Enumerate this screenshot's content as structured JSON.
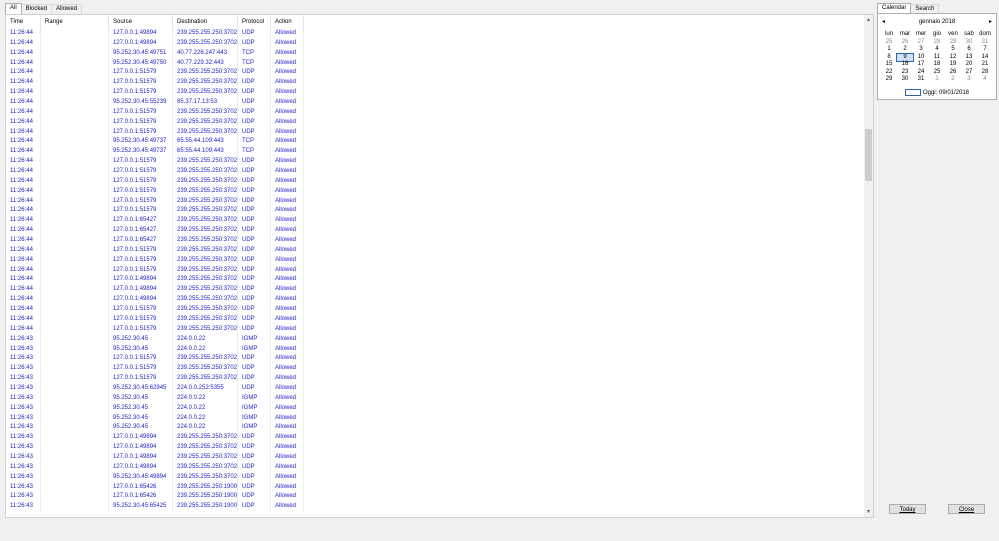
{
  "tabs": [
    "All",
    "Blocked",
    "Allowed"
  ],
  "columns": {
    "time": "Time",
    "range": "Range",
    "source": "Source",
    "destination": "Destination",
    "protocol": "Protocol",
    "action": "Action"
  },
  "rows": [
    [
      "11:26:44",
      "",
      "127.0.0.1:49894",
      "239.255.255.250:3702",
      "UDP",
      "Allowed"
    ],
    [
      "11:26:44",
      "",
      "127.0.0.1:49894",
      "239.255.255.250:3702",
      "UDP",
      "Allowed"
    ],
    [
      "11:26:44",
      "",
      "95.252.30.45:49751",
      "40.77.226.247:443",
      "TCP",
      "Allowed"
    ],
    [
      "11:26:44",
      "",
      "95.252.30.45:49750",
      "40.77.229.32:443",
      "TCP",
      "Allowed"
    ],
    [
      "11:26:44",
      "",
      "127.0.0.1:51579",
      "239.255.255.250:3702",
      "UDP",
      "Allowed"
    ],
    [
      "11:26:44",
      "",
      "127.0.0.1:51579",
      "239.255.255.250:3702",
      "UDP",
      "Allowed"
    ],
    [
      "11:26:44",
      "",
      "127.0.0.1:51579",
      "239.255.255.250:3702",
      "UDP",
      "Allowed"
    ],
    [
      "11:26:44",
      "",
      "95.252.30.45:55239",
      "85.37.17.13:53",
      "UDP",
      "Allowed"
    ],
    [
      "11:26:44",
      "",
      "127.0.0.1:51579",
      "239.255.255.250:3702",
      "UDP",
      "Allowed"
    ],
    [
      "11:26:44",
      "",
      "127.0.0.1:51579",
      "239.255.255.250:3702",
      "UDP",
      "Allowed"
    ],
    [
      "11:26:44",
      "",
      "127.0.0.1:51579",
      "239.255.255.250:3702",
      "UDP",
      "Allowed"
    ],
    [
      "11:26:44",
      "",
      "95.252.30.45:49737",
      "65.55.44.109:443",
      "TCP",
      "Allowed"
    ],
    [
      "11:26:44",
      "",
      "95.252.30.45:49737",
      "65.55.44.109:443",
      "TCP",
      "Allowed"
    ],
    [
      "11:26:44",
      "",
      "127.0.0.1:51579",
      "239.255.255.250:3702",
      "UDP",
      "Allowed"
    ],
    [
      "11:26:44",
      "",
      "127.0.0.1:51579",
      "239.255.255.250:3702",
      "UDP",
      "Allowed"
    ],
    [
      "11:26:44",
      "",
      "127.0.0.1:51579",
      "239.255.255.250:3702",
      "UDP",
      "Allowed"
    ],
    [
      "11:26:44",
      "",
      "127.0.0.1:51579",
      "239.255.255.250:3702",
      "UDP",
      "Allowed"
    ],
    [
      "11:26:44",
      "",
      "127.0.0.1:51579",
      "239.255.255.250:3702",
      "UDP",
      "Allowed"
    ],
    [
      "11:26:44",
      "",
      "127.0.0.1:51579",
      "239.255.255.250:3702",
      "UDP",
      "Allowed"
    ],
    [
      "11:26:44",
      "",
      "127.0.0.1:65427",
      "239.255.255.250:3702",
      "UDP",
      "Allowed"
    ],
    [
      "11:26:44",
      "",
      "127.0.0.1:65427",
      "239.255.255.250:3702",
      "UDP",
      "Allowed"
    ],
    [
      "11:26:44",
      "",
      "127.0.0.1:65427",
      "239.255.255.250:3702",
      "UDP",
      "Allowed"
    ],
    [
      "11:26:44",
      "",
      "127.0.0.1:51579",
      "239.255.255.250:3702",
      "UDP",
      "Allowed"
    ],
    [
      "11:26:44",
      "",
      "127.0.0.1:51579",
      "239.255.255.250:3702",
      "UDP",
      "Allowed"
    ],
    [
      "11:26:44",
      "",
      "127.0.0.1:51579",
      "239.255.255.250:3702",
      "UDP",
      "Allowed"
    ],
    [
      "11:26:44",
      "",
      "127.0.0.1:49894",
      "239.255.255.250:3702",
      "UDP",
      "Allowed"
    ],
    [
      "11:26:44",
      "",
      "127.0.0.1:49894",
      "239.255.255.250:3702",
      "UDP",
      "Allowed"
    ],
    [
      "11:26:44",
      "",
      "127.0.0.1:49894",
      "239.255.255.250:3702",
      "UDP",
      "Allowed"
    ],
    [
      "11:26:44",
      "",
      "127.0.0.1:51579",
      "239.255.255.250:3702",
      "UDP",
      "Allowed"
    ],
    [
      "11:26:44",
      "",
      "127.0.0.1:51579",
      "239.255.255.250:3702",
      "UDP",
      "Allowed"
    ],
    [
      "11:26:44",
      "",
      "127.0.0.1:51579",
      "239.255.255.250:3702",
      "UDP",
      "Allowed"
    ],
    [
      "11:26:43",
      "",
      "95.252.30.45",
      "224.0.0.22",
      "IGMP",
      "Allowed"
    ],
    [
      "11:26:43",
      "",
      "95.252.30.45",
      "224.0.0.22",
      "IGMP",
      "Allowed"
    ],
    [
      "11:26:43",
      "",
      "127.0.0.1:51579",
      "239.255.255.250:3702",
      "UDP",
      "Allowed"
    ],
    [
      "11:26:43",
      "",
      "127.0.0.1:51579",
      "239.255.255.250:3702",
      "UDP",
      "Allowed"
    ],
    [
      "11:26:43",
      "",
      "127.0.0.1:51579",
      "239.255.255.250:3702",
      "UDP",
      "Allowed"
    ],
    [
      "11:26:43",
      "",
      "95.252.30.45:62945",
      "224.0.0.252:5355",
      "UDP",
      "Allowed"
    ],
    [
      "11:26:43",
      "",
      "95.252.30.45",
      "224.0.0.22",
      "IGMP",
      "Allowed"
    ],
    [
      "11:26:43",
      "",
      "95.252.30.45",
      "224.0.0.22",
      "IGMP",
      "Allowed"
    ],
    [
      "11:26:43",
      "",
      "95.252.30.45",
      "224.0.0.22",
      "IGMP",
      "Allowed"
    ],
    [
      "11:26:43",
      "",
      "95.252.30.45",
      "224.0.0.22",
      "IGMP",
      "Allowed"
    ],
    [
      "11:26:43",
      "",
      "127.0.0.1:49894",
      "239.255.255.250:3702",
      "UDP",
      "Allowed"
    ],
    [
      "11:26:43",
      "",
      "127.0.0.1:49894",
      "239.255.255.250:3702",
      "UDP",
      "Allowed"
    ],
    [
      "11:26:43",
      "",
      "127.0.0.1:49894",
      "239.255.255.250:3702",
      "UDP",
      "Allowed"
    ],
    [
      "11:26:43",
      "",
      "127.0.0.1:49894",
      "239.255.255.250:3702",
      "UDP",
      "Allowed"
    ],
    [
      "11:26:43",
      "",
      "95.252.30.45:49894",
      "239.255.255.250:3702",
      "UDP",
      "Allowed"
    ],
    [
      "11:26:43",
      "",
      "127.0.0.1:65426",
      "239.255.255.250:1900",
      "UDP",
      "Allowed"
    ],
    [
      "11:26:43",
      "",
      "127.0.0.1:65426",
      "239.255.255.250:1900",
      "UDP",
      "Allowed"
    ],
    [
      "11:26:43",
      "",
      "95.252.30.45:65425",
      "239.255.255.250:1900",
      "UDP",
      "Allowed"
    ]
  ],
  "calendar": {
    "tabs": [
      "Calendar",
      "Search"
    ],
    "prev_icon": "◂",
    "next_icon": "▸",
    "month_label": "gennaio 2018",
    "weekdays": [
      "lun",
      "mar",
      "mer",
      "gio",
      "ven",
      "sab",
      "dom"
    ],
    "weeks": [
      [
        "25",
        "26",
        "27",
        "28",
        "29",
        "30",
        "31"
      ],
      [
        "1",
        "2",
        "3",
        "4",
        "5",
        "6",
        "7"
      ],
      [
        "8",
        "9",
        "10",
        "11",
        "12",
        "13",
        "14"
      ],
      [
        "15",
        "16",
        "17",
        "18",
        "19",
        "20",
        "21"
      ],
      [
        "22",
        "23",
        "24",
        "25",
        "26",
        "27",
        "28"
      ],
      [
        "29",
        "30",
        "31",
        "1",
        "2",
        "3",
        "4"
      ]
    ],
    "selected_day": "9",
    "today_label": "Oggi: 09/01/2018"
  },
  "scroll": {
    "up_icon": "▴",
    "down_icon": "▾"
  },
  "buttons": {
    "today": "Today",
    "close": "Close"
  }
}
